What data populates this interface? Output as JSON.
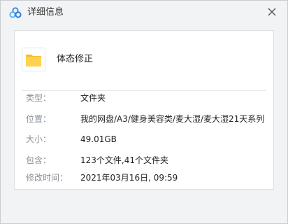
{
  "window": {
    "title": "详细信息",
    "logo_icon": "baidu-netdisk-logo-icon",
    "close_icon": "close-icon"
  },
  "item": {
    "icon": "folder-icon",
    "name": "体态修正"
  },
  "details": [
    {
      "key": "类型：",
      "value": "文件夹"
    },
    {
      "key": "位置：",
      "value": "我的网盘/A3/健身美容类/麦大湿/麦大湿21天系列"
    },
    {
      "key": "大小：",
      "value": "49.01GB"
    },
    {
      "key": "包含：",
      "value": "123个文件,41个文件夹"
    },
    {
      "key": "修改时间：",
      "value": "2021年03月16日, 09:59"
    }
  ],
  "colors": {
    "logo_blue": "#3a8ee6",
    "folder_yellow": "#ffd24d",
    "folder_tab": "#f5bd2a"
  }
}
